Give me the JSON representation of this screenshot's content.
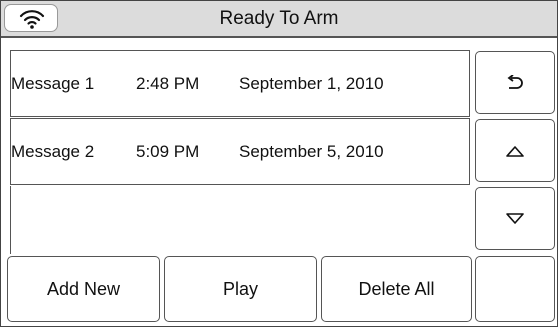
{
  "status": {
    "title": "Ready To Arm",
    "wifi_icon": "wifi-icon"
  },
  "messages": [
    {
      "name": "Message 1",
      "time": "2:48 PM",
      "date": "September 1, 2010"
    },
    {
      "name": "Message 2",
      "time": "5:09 PM",
      "date": "September 5, 2010"
    }
  ],
  "side_buttons": {
    "back_icon": "back-arrow-icon",
    "up_icon": "triangle-up-icon",
    "down_icon": "triangle-down-icon"
  },
  "bottom_buttons": {
    "add_new": "Add New",
    "play": "Play",
    "delete_all": "Delete All"
  }
}
